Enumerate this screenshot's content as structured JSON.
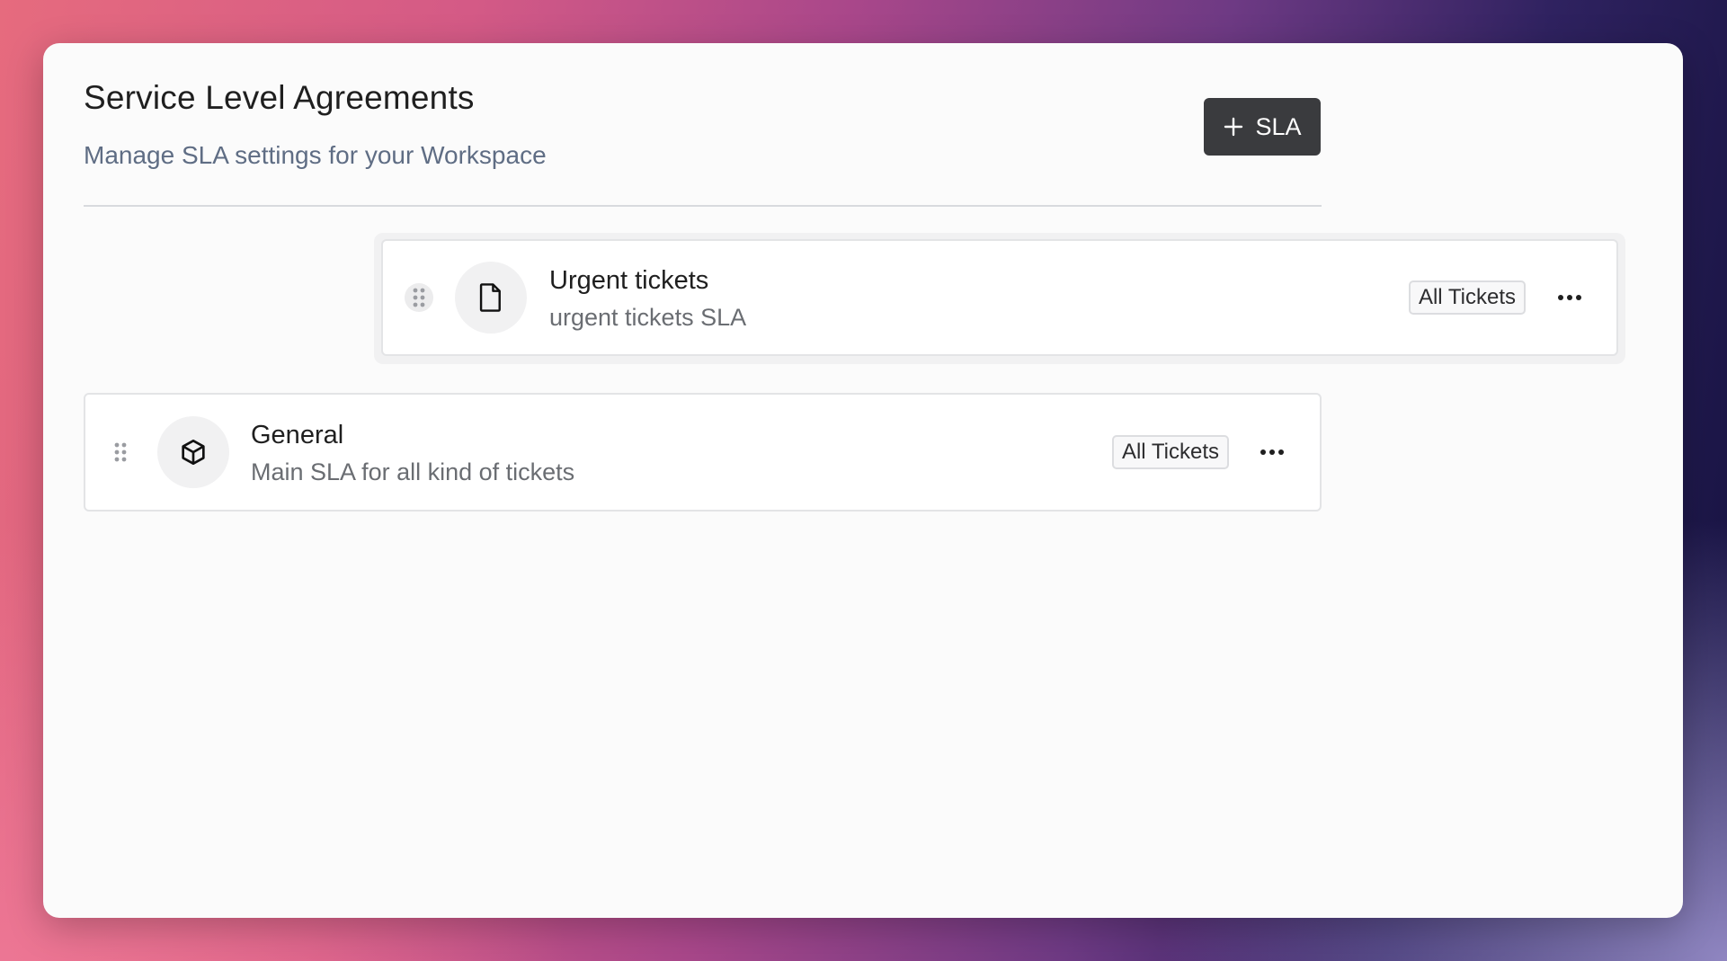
{
  "header": {
    "title": "Service Level Agreements",
    "subtitle": "Manage SLA settings for your Workspace",
    "add_button_label": "SLA",
    "add_button_icon": "plus-icon"
  },
  "sla_list": [
    {
      "title": "Urgent tickets",
      "description": "urgent tickets SLA",
      "icon": "file-icon",
      "badge": "All Tickets",
      "state": "dragging"
    },
    {
      "title": "General",
      "description": "Main SLA for all kind of tickets",
      "icon": "cube-icon",
      "badge": "All Tickets"
    }
  ],
  "colors": {
    "primary_button": "#3a3b3e",
    "subtitle_text": "#5f6d84"
  }
}
